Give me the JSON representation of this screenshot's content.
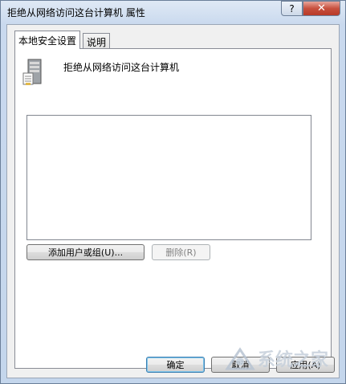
{
  "window": {
    "title": "拒绝从网络访问这台计算机 属性",
    "help_label": "?",
    "close_label": "✕"
  },
  "tabs": [
    {
      "label": "本地安全设置",
      "active": true
    },
    {
      "label": "说明",
      "active": false
    }
  ],
  "policy": {
    "title": "拒绝从网络访问这台计算机",
    "icon": "server-icon"
  },
  "user_list": {
    "items": []
  },
  "buttons": {
    "add": "添加用户或组(U)...",
    "remove": "删除(R)",
    "ok": "确定",
    "cancel": "取消",
    "apply": "应用(A)"
  },
  "watermark": {
    "text": "系统之家"
  },
  "colors": {
    "close_button": "#c7503e",
    "window_frame": "#c4d6ec",
    "client_bg": "#f0f0f0"
  }
}
